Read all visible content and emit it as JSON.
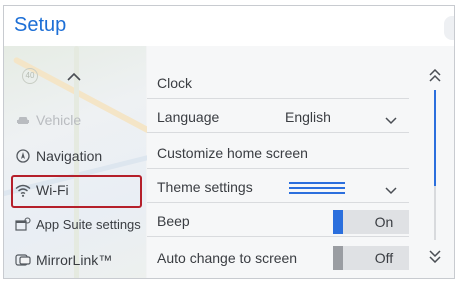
{
  "header": {
    "title": "Setup"
  },
  "sidebar": {
    "items": [
      {
        "label": "Vehicle",
        "icon": "car-icon",
        "enabled": false
      },
      {
        "label": "Navigation",
        "icon": "navigation-icon",
        "enabled": true
      },
      {
        "label": "Wi-Fi",
        "icon": "wifi-icon",
        "enabled": true,
        "highlighted": true
      },
      {
        "label": "App Suite settings",
        "icon": "app-suite-icon",
        "enabled": true
      },
      {
        "label": "MirrorLink™",
        "icon": "mirrorlink-icon",
        "enabled": true
      }
    ]
  },
  "settings": {
    "clock": {
      "label": "Clock"
    },
    "language": {
      "label": "Language",
      "value": "English"
    },
    "customize": {
      "label": "Customize home screen"
    },
    "theme": {
      "label": "Theme settings"
    },
    "beep": {
      "label": "Beep",
      "state": "On"
    },
    "auto_change": {
      "label": "Auto change to screen",
      "state": "Off"
    }
  },
  "colors": {
    "accent": "#2b6fdd",
    "title": "#1d6fd6",
    "highlight_border": "#b51f2a",
    "toggle_off_bar": "#9a9da2"
  },
  "scrollbar": {
    "visible_fraction": 0.64,
    "position": 0.0
  }
}
